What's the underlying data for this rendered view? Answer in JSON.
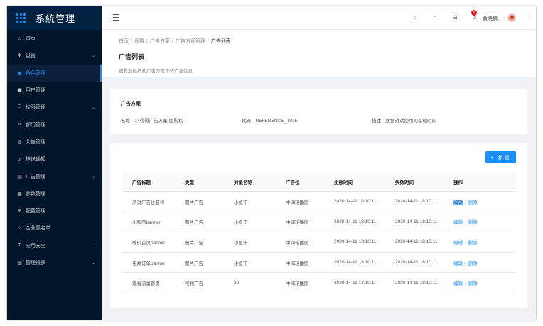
{
  "app": {
    "title": "系統管理"
  },
  "sidebar": {
    "items": [
      {
        "label": "首页",
        "icon": "home-icon",
        "glyph": "⌂",
        "caret": false,
        "active": false
      },
      {
        "label": "设置",
        "icon": "gear-icon",
        "glyph": "✲",
        "caret": true,
        "active": false
      },
      {
        "label": "角色管理",
        "icon": "user-circle-icon",
        "glyph": "◉",
        "caret": false,
        "active": true
      },
      {
        "label": "用户管理",
        "icon": "id-card-icon",
        "glyph": "▣",
        "caret": false,
        "active": false
      },
      {
        "label": "权限管理",
        "icon": "shield-icon",
        "glyph": "⛉",
        "caret": true,
        "active": false
      },
      {
        "label": "部门管理",
        "icon": "team-icon",
        "glyph": "⚇",
        "caret": false,
        "active": false
      },
      {
        "label": "公告管理",
        "icon": "sound-icon",
        "glyph": "◎",
        "caret": false,
        "active": false
      },
      {
        "label": "推送通知",
        "icon": "bell-icon",
        "glyph": "♪",
        "caret": false,
        "active": false
      },
      {
        "label": "广告管理",
        "icon": "picture-icon",
        "glyph": "▤",
        "caret": true,
        "active": false
      },
      {
        "label": "参数管理",
        "icon": "table-icon",
        "glyph": "▦",
        "caret": false,
        "active": false
      },
      {
        "label": "配置管理",
        "icon": "config-icon",
        "glyph": "⊞",
        "caret": false,
        "active": false
      },
      {
        "label": "企业黑名单",
        "icon": "appstore-icon",
        "glyph": "⁘",
        "caret": false,
        "active": false
      },
      {
        "label": "应用安全",
        "icon": "lock-icon",
        "glyph": "⚿",
        "caret": true,
        "active": false
      },
      {
        "label": "管理报表",
        "icon": "report-icon",
        "glyph": "▧",
        "caret": true,
        "active": false
      }
    ]
  },
  "header": {
    "notification_count": "5",
    "user_name": "黄晓鹏"
  },
  "breadcrumb": [
    "首页",
    "设置",
    "广告方案",
    "广告方案管理",
    "广告列表"
  ],
  "page": {
    "title": "广告列表",
    "description": "查看及维护此广告方案下的广告信息"
  },
  "plan": {
    "title": "广告方案",
    "fields": [
      {
        "label": "名称：",
        "value": "14得哥广告方案-国购机"
      },
      {
        "label": "代码：",
        "value": "REFERENCE_TIME"
      },
      {
        "label": "描述：",
        "value": "数据对话使用的基础时间"
      }
    ]
  },
  "table": {
    "new_button": "+ 新建",
    "columns": [
      "广告标题",
      "类型",
      "对象名称",
      "广告位",
      "生效时间",
      "失效时间",
      "操作"
    ],
    "rows": [
      {
        "title": "测试广告位名称",
        "type": "图片广告",
        "target": "小鱼干",
        "slot": "中间轮播图",
        "start": "2020-14-11 18:10:11",
        "end": "2020-14-11 18:10:11",
        "edit": "编辑",
        "delete": "删除"
      },
      {
        "title": "小程序banner",
        "type": "图片广告",
        "target": "小鱼干",
        "slot": "中间轮播图",
        "start": "2020-14-11 18:10:11",
        "end": "2020-14-11 18:10:11",
        "edit": "编辑",
        "delete": "删除"
      },
      {
        "title": "敬价首页banner",
        "type": "图片广告",
        "target": "小鱼干",
        "slot": "中间轮播图",
        "start": "2020-14-11 18:10:11",
        "end": "2020-14-11 18:10:11",
        "edit": "编辑",
        "delete": "删除"
      },
      {
        "title": "电商订单banner",
        "type": "图片广告",
        "target": "小鱼干",
        "slot": "中间轮播图",
        "start": "2020-14-11 18:10:11",
        "end": "2020-14-11 18:10:11",
        "edit": "编辑",
        "delete": "删除"
      },
      {
        "title": "观看流量首页",
        "type": "视频广告",
        "target": "30",
        "slot": "中间轮播图",
        "start": "2020-14-11 18:10:11",
        "end": "2020-14-11 18:10:11",
        "edit": "编辑",
        "delete": "删除"
      }
    ]
  },
  "colors": {
    "sidebar": "#001529",
    "accent": "#1890ff",
    "badge": "#f5222d"
  }
}
